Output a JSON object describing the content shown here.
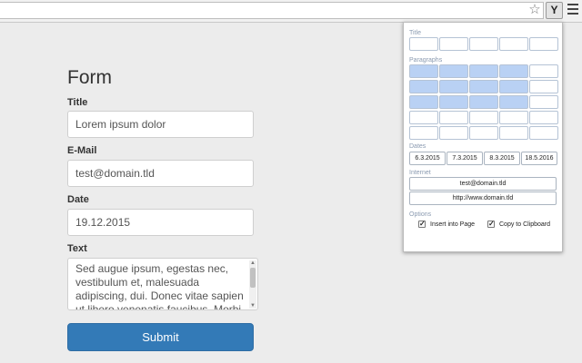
{
  "toolbar": {
    "ext_label": "Y",
    "star_glyph": "☆",
    "menu_icon": "hamburger"
  },
  "form": {
    "title": "Form",
    "fields": [
      {
        "label": "Title",
        "value": "Lorem ipsum dolor"
      },
      {
        "label": "E-Mail",
        "value": "test@domain.tld"
      },
      {
        "label": "Date",
        "value": "19.12.2015"
      }
    ],
    "text_label": "Text",
    "text_value": "Sed augue ipsum, egestas nec, vestibulum et, malesuada adipiscing, dui. Donec vitae sapien ut libero venenatis faucibus. Morbi nec metus.",
    "submit": "Submit"
  },
  "popup": {
    "title_section": "Title",
    "paragraphs_section": "Paragraphs",
    "dates_section": "Dates",
    "dates": [
      "6.3.2015",
      "7.3.2015",
      "8.3.2015",
      "18.5.2016"
    ],
    "internet_section": "Internet",
    "email": "test@domain.tld",
    "url": "http://www.domain.tld",
    "options_section": "Options",
    "options": [
      {
        "label": "Insert into Page",
        "checked": true
      },
      {
        "label": "Copy to Clipboard",
        "checked": true
      }
    ],
    "highlight_color": "#b9d1f4"
  }
}
